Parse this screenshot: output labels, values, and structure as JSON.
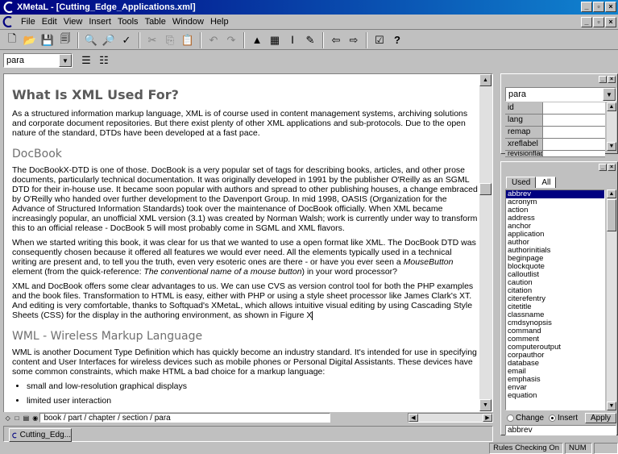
{
  "window": {
    "title": "XMetaL - [Cutting_Edge_Applications.xml]"
  },
  "menu": [
    "File",
    "Edit",
    "View",
    "Insert",
    "Tools",
    "Table",
    "Window",
    "Help"
  ],
  "toolbar1": [
    "new-icon",
    "open-icon",
    "save-icon",
    "save-all-icon",
    "find-icon",
    "replace-icon",
    "spellcheck-icon",
    "cut-icon",
    "copy-icon",
    "paste-icon",
    "undo-icon",
    "redo-icon",
    "image-icon",
    "table-icon",
    "cursor-icon",
    "bold-icon",
    "back-icon",
    "forward-icon",
    "validate-icon",
    "help-icon"
  ],
  "style_combo": {
    "value": "para"
  },
  "document": {
    "title": "What Is XML Used For?",
    "intro": "As a structured information markup language, XML is of course used in content management systems, archiving solutions and corporate document repositories. But there exist plenty of other XML applications and sub-protocols. Due to the open nature of the standard, DTDs have been developed at a fast pace.",
    "section1": {
      "heading": "DocBook",
      "p1": "The DocBookX-DTD is one of those. DocBook is a very popular set of tags for describing books, articles, and other prose documents, particularly technical documentation. It was originally developed in 1991 by the publisher O'Reilly as an SGML DTD for their in-house use. It became soon popular with authors and spread to other publishing houses, a change embraced by O'Reilly who handed over further development to the Davenport Group. In mid 1998, OASIS (Organization for the Advance of Structured Information Standards) took over the maintenance of DocBook officially. When XML became increasingly popular, an unofficial XML version (3.1) was created by Norman Walsh; work is currently under way to transform this to an official release - DocBook 5 will most probably come in SGML and XML flavors.",
      "p2_a": "When we started writing this book, it was clear for us that we wanted to use a open format like XML. The DocBook DTD was consequently chosen because it offered all features we would ever need. All the elements typically used in a technical writing are present and, to tell you the truth, even very esoteric ones are there - or have you ever seen a ",
      "p2_em1": "MouseButton",
      "p2_b": " element (from the quick-reference: ",
      "p2_em2": "The conventional name of a mouse button",
      "p2_c": ") in your word processor?",
      "p3": "XML and DocBook offers some clear advantages to us. We can use CVS as version control tool for both the PHP examples and the book files. Transformation to HTML is easy, either with PHP or using a style sheet processor like James Clark's XT. And editing is very comfortable, thanks to Softquad's XMetaL, which allows intuitive visual editing by using Cascading Style Sheets (CSS) for the display in the authoring environment, as shown in Figure X"
    },
    "section2": {
      "heading": "WML - Wireless Markup Language",
      "p1": "WML is another Document Type Definition which has quickly become an industry standard. It's intended for use in specifying content and User Interfaces for wireless devices such as mobile phones or Personal Digital Assistants. These devices have some common constraints, which make HTML a bad choice for a markup language:",
      "bullets": [
        "small and low-resolution graphical displays",
        "limited user interaction"
      ]
    }
  },
  "pathbar": {
    "path": "book / part / chapter / section / para"
  },
  "doc_tab": {
    "label": "Cutting_Edg..."
  },
  "attributes": {
    "combo": "para",
    "rows": [
      "id",
      "lang",
      "remap",
      "xreflabel",
      "revisionflag"
    ]
  },
  "elements": {
    "tabs": [
      "Used",
      "All"
    ],
    "active_tab": "All",
    "items": [
      "abbrev",
      "acronym",
      "action",
      "address",
      "anchor",
      "application",
      "author",
      "authorinitials",
      "beginpage",
      "blockquote",
      "calloutlist",
      "caution",
      "citation",
      "citerefentry",
      "citetitle",
      "classname",
      "cmdsynopsis",
      "command",
      "comment",
      "computeroutput",
      "corpauthor",
      "database",
      "email",
      "emphasis",
      "envar",
      "equation"
    ],
    "selected": "abbrev",
    "mode_change": "Change",
    "mode_insert": "Insert",
    "apply": "Apply",
    "input_value": "abbrev"
  },
  "status": {
    "rules": "Rules Checking On",
    "num": "NUM"
  }
}
